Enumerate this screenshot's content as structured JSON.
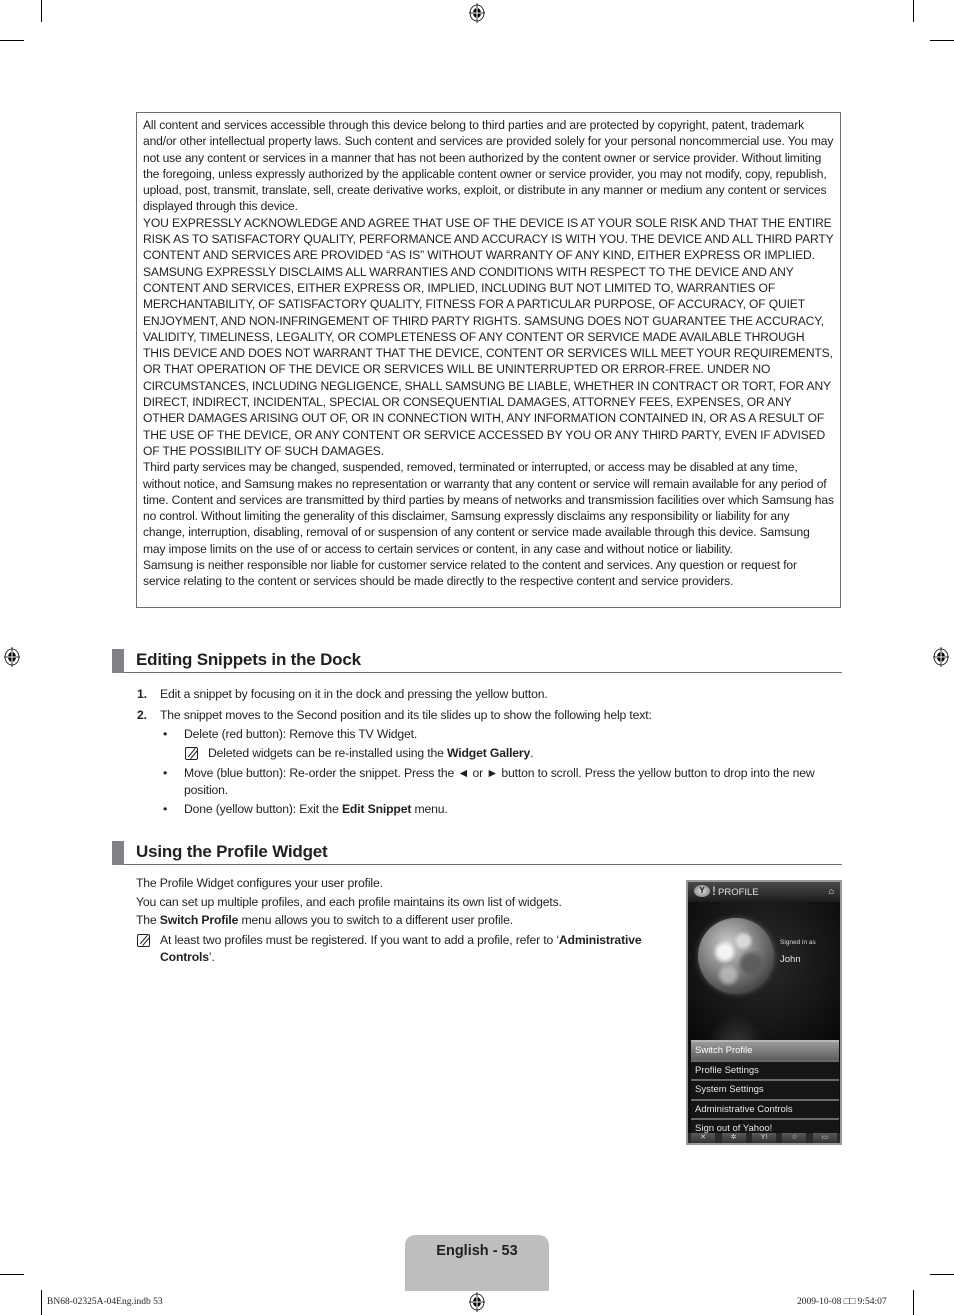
{
  "disclaimer": {
    "paragraphs": [
      "All content and services accessible through this device belong to third parties and are protected by copyright, patent, trademark and/or other intellectual property laws. Such content and services are provided solely for your personal noncommercial use. You may not use any content or services in a manner that has not been authorized by the content owner or service provider. Without limiting the foregoing, unless expressly authorized by the applicable content owner or service provider, you may not modify, copy, republish, upload, post, transmit, translate, sell, create derivative works, exploit, or distribute in any manner or medium any content or services displayed through this device.",
      "YOU EXPRESSLY ACKNOWLEDGE AND AGREE THAT USE OF THE DEVICE IS AT YOUR SOLE RISK AND THAT THE ENTIRE RISK AS TO SATISFACTORY QUALITY, PERFORMANCE AND ACCURACY IS WITH YOU. THE DEVICE AND ALL THIRD PARTY CONTENT AND SERVICES ARE PROVIDED “AS IS” WITHOUT WARRANTY OF ANY KIND, EITHER EXPRESS OR IMPLIED. SAMSUNG EXPRESSLY DISCLAIMS ALL WARRANTIES AND CONDITIONS WITH RESPECT TO THE DEVICE AND ANY CONTENT AND SERVICES, EITHER EXPRESS OR, IMPLIED, INCLUDING BUT NOT LIMITED TO, WARRANTIES OF MERCHANTABILITY, OF SATISFACTORY QUALITY, FITNESS FOR A PARTICULAR PURPOSE, OF ACCURACY, OF QUIET ENJOYMENT, AND NON-INFRINGEMENT OF THIRD PARTY RIGHTS. SAMSUNG DOES NOT GUARANTEE THE ACCURACY, VALIDITY, TIMELINESS, LEGALITY, OR COMPLETENESS OF ANY CONTENT OR SERVICE MADE AVAILABLE THROUGH THIS DEVICE AND DOES NOT WARRANT THAT THE DEVICE, CONTENT OR SERVICES WILL MEET YOUR REQUIREMENTS, OR THAT OPERATION OF THE DEVICE OR SERVICES WILL BE UNINTERRUPTED OR ERROR-FREE. UNDER NO CIRCUMSTANCES, INCLUDING NEGLIGENCE, SHALL SAMSUNG BE LIABLE, WHETHER IN CONTRACT OR TORT, FOR ANY DIRECT, INDIRECT, INCIDENTAL, SPECIAL OR CONSEQUENTIAL DAMAGES, ATTORNEY FEES, EXPENSES, OR ANY OTHER DAMAGES ARISING OUT OF, OR IN CONNECTION WITH, ANY INFORMATION CONTAINED IN, OR AS A RESULT OF THE USE OF THE DEVICE, OR ANY CONTENT OR SERVICE ACCESSED BY YOU OR ANY THIRD PARTY, EVEN IF ADVISED OF THE POSSIBILITY OF SUCH DAMAGES.",
      "Third party services may be changed, suspended, removed, terminated or interrupted, or access may be disabled at any time, without notice, and Samsung makes no representation or warranty that any content or service will remain available for any period of time. Content and services are transmitted by third parties by means of networks and transmission facilities over which Samsung has no control. Without limiting the generality of this disclaimer, Samsung expressly disclaims any responsibility or liability for any change, interruption, disabling, removal of or suspension of any content or service made available through this device. Samsung may impose limits on the use of or access to certain services or content, in any case and without notice or liability.",
      "Samsung is neither responsible nor liable for customer service related to the content and services. Any question or request for service relating to the content or services should be made directly to the respective content and service providers."
    ]
  },
  "section_editing": {
    "title": "Editing Snippets in the Dock",
    "steps": [
      {
        "num": "1.",
        "text": "Edit a snippet by focusing on it in the dock and pressing the yellow button."
      },
      {
        "num": "2.",
        "text": "The snippet moves to the Second position and its tile slides up to show the following help text:"
      }
    ],
    "bullets": [
      {
        "mark": "•",
        "text": "Delete (red button): Remove this TV Widget."
      },
      {
        "mark": "•",
        "text": "Move (blue button): Re-order the snippet. Press the ◄ or ► button to scroll. Press the yellow button to drop into the new position."
      },
      {
        "mark": "•",
        "text_pre": "Done (yellow button): Exit the ",
        "text_bold": "Edit Snippet",
        "text_post": " menu."
      }
    ],
    "note": {
      "pre": "Deleted widgets can be re-installed using the ",
      "bold": "Widget Gallery",
      "post": "."
    }
  },
  "section_profile": {
    "title": "Using the Profile Widget",
    "line1": "The Profile Widget configures your user profile.",
    "line2": "You can set up multiple profiles, and each profile maintains its own list of widgets.",
    "line3_pre": "The ",
    "line3_bold": "Switch Profile",
    "line3_post": " menu allows you to switch to a different user profile.",
    "note_pre": "At least two profiles must be registered. If you want to add a profile, refer to ‘",
    "note_bold1": "Administrative",
    "note_bold2": "Controls",
    "note_post": "’."
  },
  "widget": {
    "logo": "Y",
    "logo_mark": "!",
    "title": "PROFILE",
    "home_icon": "⌂",
    "signed_in_label": "Signed in as",
    "user_name": "John",
    "menu": [
      {
        "label": "Switch Profile",
        "active": true
      },
      {
        "label": "Profile Settings",
        "active": false
      },
      {
        "label": "System Settings",
        "active": false
      },
      {
        "label": "Administrative Controls",
        "active": false
      },
      {
        "label": "Sign out of Yahoo!",
        "active": false
      }
    ],
    "dock": [
      "✕",
      "✲",
      "Y!",
      "☆",
      "▭"
    ]
  },
  "footer": {
    "page_label": "English - 53",
    "slug_left": "BN68-02325A-04Eng.indb   53",
    "slug_right": "2009-10-08   □□ 9:54:07"
  }
}
